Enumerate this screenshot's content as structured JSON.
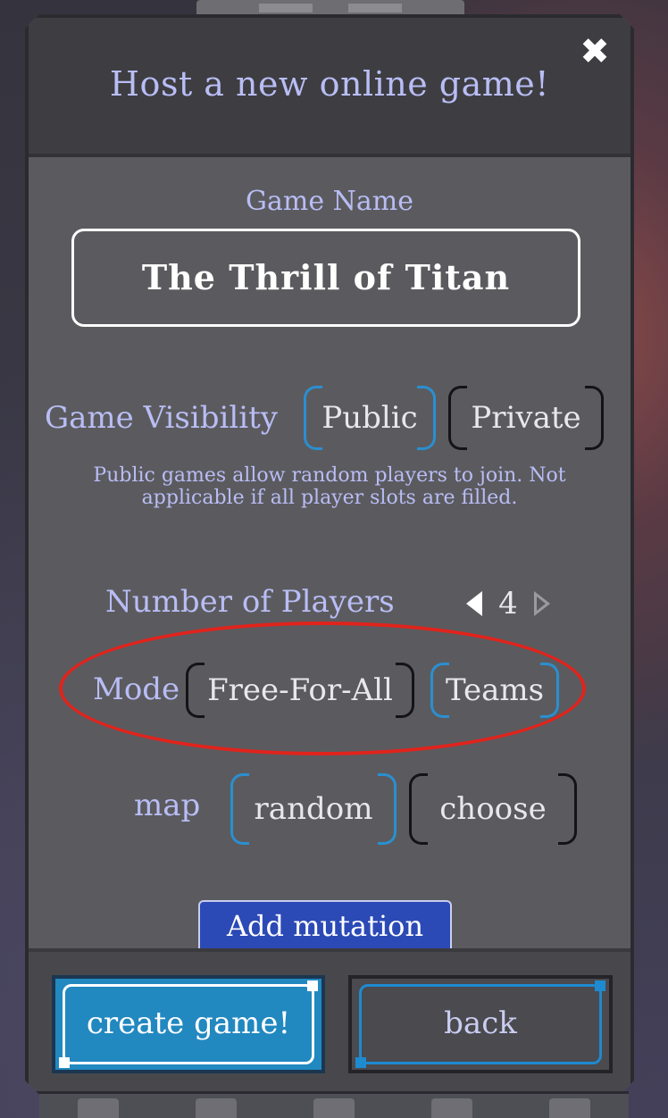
{
  "header": {
    "title": "Host a new online game!",
    "close_icon": "close-icon"
  },
  "game_name": {
    "label": "Game Name",
    "value": "The Thrill of Titan"
  },
  "visibility": {
    "label": "Game Visibility",
    "options": [
      "Public",
      "Private"
    ],
    "selected": "Public",
    "help": "Public games allow random players to join. Not applicable if all player slots are filled."
  },
  "players": {
    "label": "Number of Players",
    "count": "4",
    "left_icon": "arrow-left-icon",
    "right_icon": "arrow-right-icon"
  },
  "mode": {
    "label": "Mode",
    "options": [
      "Free-For-All",
      "Teams"
    ],
    "selected": "Teams"
  },
  "map": {
    "label": "map",
    "options": [
      "random",
      "choose"
    ],
    "selected": "random"
  },
  "buttons": {
    "add_mutation": "Add mutation",
    "create": "create game!",
    "back": "back"
  },
  "colors": {
    "panel": "#5b5b5f",
    "label_text": "#b9bdf5",
    "selected_border": "#2a8fd0",
    "primary_button": "#2288c0",
    "highlight_circle": "#e0231c"
  }
}
